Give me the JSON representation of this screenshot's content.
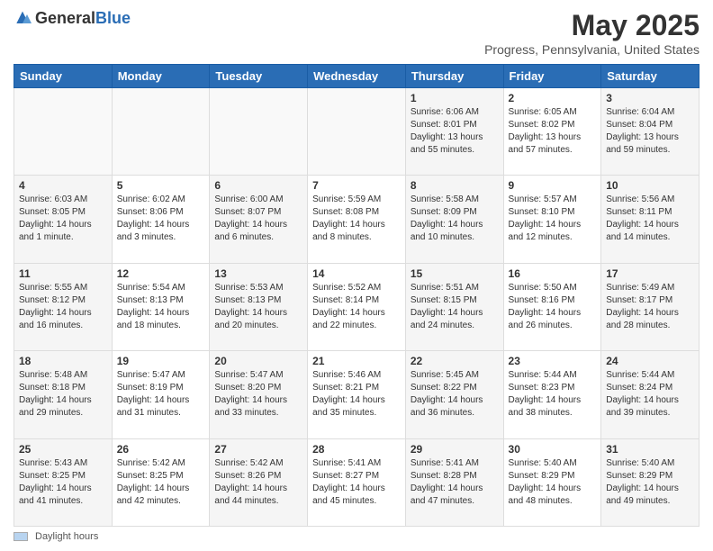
{
  "logo": {
    "text_general": "General",
    "text_blue": "Blue"
  },
  "header": {
    "title": "May 2025",
    "subtitle": "Progress, Pennsylvania, United States"
  },
  "days_of_week": [
    "Sunday",
    "Monday",
    "Tuesday",
    "Wednesday",
    "Thursday",
    "Friday",
    "Saturday"
  ],
  "weeks": [
    [
      {
        "day": "",
        "info": ""
      },
      {
        "day": "",
        "info": ""
      },
      {
        "day": "",
        "info": ""
      },
      {
        "day": "",
        "info": ""
      },
      {
        "day": "1",
        "info": "Sunrise: 6:06 AM\nSunset: 8:01 PM\nDaylight: 13 hours\nand 55 minutes."
      },
      {
        "day": "2",
        "info": "Sunrise: 6:05 AM\nSunset: 8:02 PM\nDaylight: 13 hours\nand 57 minutes."
      },
      {
        "day": "3",
        "info": "Sunrise: 6:04 AM\nSunset: 8:04 PM\nDaylight: 13 hours\nand 59 minutes."
      }
    ],
    [
      {
        "day": "4",
        "info": "Sunrise: 6:03 AM\nSunset: 8:05 PM\nDaylight: 14 hours\nand 1 minute."
      },
      {
        "day": "5",
        "info": "Sunrise: 6:02 AM\nSunset: 8:06 PM\nDaylight: 14 hours\nand 3 minutes."
      },
      {
        "day": "6",
        "info": "Sunrise: 6:00 AM\nSunset: 8:07 PM\nDaylight: 14 hours\nand 6 minutes."
      },
      {
        "day": "7",
        "info": "Sunrise: 5:59 AM\nSunset: 8:08 PM\nDaylight: 14 hours\nand 8 minutes."
      },
      {
        "day": "8",
        "info": "Sunrise: 5:58 AM\nSunset: 8:09 PM\nDaylight: 14 hours\nand 10 minutes."
      },
      {
        "day": "9",
        "info": "Sunrise: 5:57 AM\nSunset: 8:10 PM\nDaylight: 14 hours\nand 12 minutes."
      },
      {
        "day": "10",
        "info": "Sunrise: 5:56 AM\nSunset: 8:11 PM\nDaylight: 14 hours\nand 14 minutes."
      }
    ],
    [
      {
        "day": "11",
        "info": "Sunrise: 5:55 AM\nSunset: 8:12 PM\nDaylight: 14 hours\nand 16 minutes."
      },
      {
        "day": "12",
        "info": "Sunrise: 5:54 AM\nSunset: 8:13 PM\nDaylight: 14 hours\nand 18 minutes."
      },
      {
        "day": "13",
        "info": "Sunrise: 5:53 AM\nSunset: 8:13 PM\nDaylight: 14 hours\nand 20 minutes."
      },
      {
        "day": "14",
        "info": "Sunrise: 5:52 AM\nSunset: 8:14 PM\nDaylight: 14 hours\nand 22 minutes."
      },
      {
        "day": "15",
        "info": "Sunrise: 5:51 AM\nSunset: 8:15 PM\nDaylight: 14 hours\nand 24 minutes."
      },
      {
        "day": "16",
        "info": "Sunrise: 5:50 AM\nSunset: 8:16 PM\nDaylight: 14 hours\nand 26 minutes."
      },
      {
        "day": "17",
        "info": "Sunrise: 5:49 AM\nSunset: 8:17 PM\nDaylight: 14 hours\nand 28 minutes."
      }
    ],
    [
      {
        "day": "18",
        "info": "Sunrise: 5:48 AM\nSunset: 8:18 PM\nDaylight: 14 hours\nand 29 minutes."
      },
      {
        "day": "19",
        "info": "Sunrise: 5:47 AM\nSunset: 8:19 PM\nDaylight: 14 hours\nand 31 minutes."
      },
      {
        "day": "20",
        "info": "Sunrise: 5:47 AM\nSunset: 8:20 PM\nDaylight: 14 hours\nand 33 minutes."
      },
      {
        "day": "21",
        "info": "Sunrise: 5:46 AM\nSunset: 8:21 PM\nDaylight: 14 hours\nand 35 minutes."
      },
      {
        "day": "22",
        "info": "Sunrise: 5:45 AM\nSunset: 8:22 PM\nDaylight: 14 hours\nand 36 minutes."
      },
      {
        "day": "23",
        "info": "Sunrise: 5:44 AM\nSunset: 8:23 PM\nDaylight: 14 hours\nand 38 minutes."
      },
      {
        "day": "24",
        "info": "Sunrise: 5:44 AM\nSunset: 8:24 PM\nDaylight: 14 hours\nand 39 minutes."
      }
    ],
    [
      {
        "day": "25",
        "info": "Sunrise: 5:43 AM\nSunset: 8:25 PM\nDaylight: 14 hours\nand 41 minutes."
      },
      {
        "day": "26",
        "info": "Sunrise: 5:42 AM\nSunset: 8:25 PM\nDaylight: 14 hours\nand 42 minutes."
      },
      {
        "day": "27",
        "info": "Sunrise: 5:42 AM\nSunset: 8:26 PM\nDaylight: 14 hours\nand 44 minutes."
      },
      {
        "day": "28",
        "info": "Sunrise: 5:41 AM\nSunset: 8:27 PM\nDaylight: 14 hours\nand 45 minutes."
      },
      {
        "day": "29",
        "info": "Sunrise: 5:41 AM\nSunset: 8:28 PM\nDaylight: 14 hours\nand 47 minutes."
      },
      {
        "day": "30",
        "info": "Sunrise: 5:40 AM\nSunset: 8:29 PM\nDaylight: 14 hours\nand 48 minutes."
      },
      {
        "day": "31",
        "info": "Sunrise: 5:40 AM\nSunset: 8:29 PM\nDaylight: 14 hours\nand 49 minutes."
      }
    ]
  ],
  "footer": {
    "legend_label": "Daylight hours"
  }
}
